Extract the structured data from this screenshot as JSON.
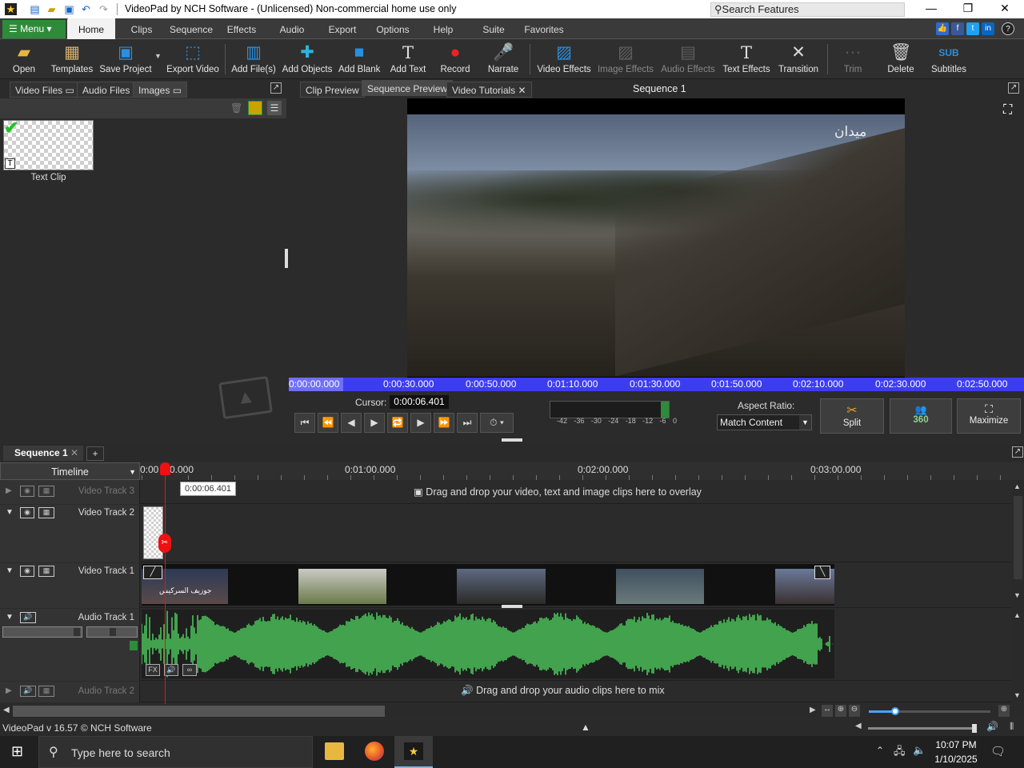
{
  "app": {
    "title": "VideoPad by NCH Software - (Unlicensed) Non-commercial home use only",
    "search_placeholder": "Search Features"
  },
  "menu": {
    "menu_label": "Menu",
    "tabs": [
      "Home",
      "Clips",
      "Sequence",
      "Effects",
      "Audio",
      "Export",
      "Options",
      "Help",
      "Suite",
      "Favorites"
    ]
  },
  "toolbar": {
    "items": [
      {
        "label": "Open",
        "icon": "folder-icon",
        "enabled": true
      },
      {
        "label": "Templates",
        "icon": "templates-icon",
        "enabled": true
      },
      {
        "label": "Save Project",
        "icon": "save-icon",
        "enabled": true
      },
      {
        "label": "Export Video",
        "icon": "export-video-icon",
        "enabled": true
      },
      {
        "label": "Add File(s)",
        "icon": "add-files-icon",
        "enabled": true
      },
      {
        "label": "Add Objects",
        "icon": "add-objects-icon",
        "enabled": true
      },
      {
        "label": "Add Blank",
        "icon": "add-blank-icon",
        "enabled": true
      },
      {
        "label": "Add Text",
        "icon": "add-text-icon",
        "enabled": true
      },
      {
        "label": "Record",
        "icon": "record-icon",
        "enabled": true
      },
      {
        "label": "Narrate",
        "icon": "microphone-icon",
        "enabled": true
      },
      {
        "label": "Video Effects",
        "icon": "video-effects-icon",
        "enabled": true
      },
      {
        "label": "Image Effects",
        "icon": "image-effects-icon",
        "enabled": false
      },
      {
        "label": "Audio Effects",
        "icon": "audio-effects-icon",
        "enabled": false
      },
      {
        "label": "Text Effects",
        "icon": "text-effects-icon",
        "enabled": true
      },
      {
        "label": "Transition",
        "icon": "transition-icon",
        "enabled": true
      },
      {
        "label": "Trim",
        "icon": "trim-icon",
        "enabled": false
      },
      {
        "label": "Delete",
        "icon": "trash-icon",
        "enabled": true
      },
      {
        "label": "Subtitles",
        "icon": "subtitles-icon",
        "enabled": true
      }
    ]
  },
  "media": {
    "tabs": [
      "Video Files",
      "Audio Files",
      "Images"
    ],
    "clip_label": "Text Clip"
  },
  "preview": {
    "tabs": [
      "Clip Preview",
      "Sequence Preview",
      "Video Tutorials"
    ],
    "sequence_title": "Sequence 1",
    "watermark": "ميدان",
    "ruler_ticks": [
      "0:00:00.000",
      "0:00:30.000",
      "0:00:50.000",
      "0:01:10.000",
      "0:01:30.000",
      "0:01:50.000",
      "0:02:10.000",
      "0:02:30.000",
      "0:02:50.000"
    ],
    "cursor_label": "Cursor:",
    "cursor_value": "0:00:06.401",
    "meter_scale": [
      "-42",
      "-36",
      "-30",
      "-24",
      "-18",
      "-12",
      "-6",
      "0"
    ],
    "aspect_label": "Aspect Ratio:",
    "aspect_value": "Match Content",
    "split_label": "Split",
    "btn360_label": "360",
    "maximize_label": "Maximize"
  },
  "timeline": {
    "sequence_tab": "Sequence 1",
    "add_tab": "+",
    "timeline_label": "Timeline",
    "ruler_ticks": [
      "0:00",
      "0.000",
      "0:01:00.000",
      "0:02:00.000",
      "0:03:00.000"
    ],
    "cursor_tooltip": "0:00:06.401",
    "tracks": {
      "video3": "Video Track 3",
      "video2": "Video Track 2",
      "video1": "Video Track 1",
      "audio1": "Audio Track 1",
      "audio2": "Audio Track 2"
    },
    "overlay_hint": "Drag and drop your video, text and image clips here to overlay",
    "mix_hint": "Drag and drop your audio clips here to mix",
    "clip1_caption": "جوزيف السركيس",
    "fx_label": "FX"
  },
  "status": {
    "version": "VideoPad v 16.57 © NCH Software"
  },
  "taskbar": {
    "search_placeholder": "Type here to search",
    "time": "10:07 PM",
    "date": "1/10/2025"
  },
  "colors": {
    "accent_green": "#2e8b3a",
    "ruler_blue": "#3d3df0",
    "waveform": "#4cc35a",
    "playhead": "#e11"
  }
}
